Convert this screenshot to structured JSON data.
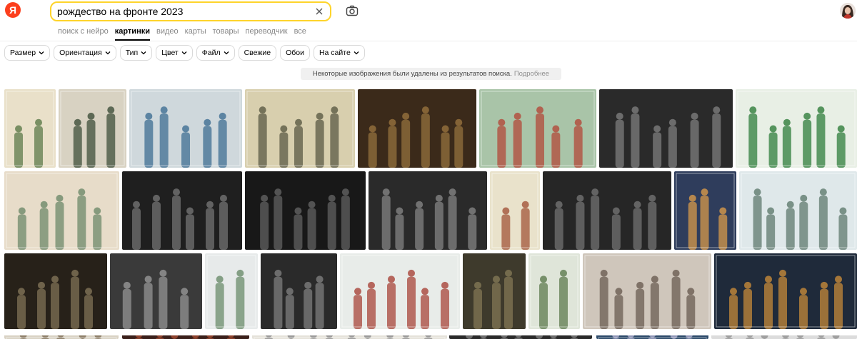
{
  "logo": {
    "letter": "Я"
  },
  "search": {
    "query": "рождество на фронте 2023"
  },
  "tabs": [
    {
      "label": "поиск с нейро",
      "active": false
    },
    {
      "label": "картинки",
      "active": true
    },
    {
      "label": "видео",
      "active": false
    },
    {
      "label": "карты",
      "active": false
    },
    {
      "label": "товары",
      "active": false
    },
    {
      "label": "переводчик",
      "active": false
    },
    {
      "label": "все",
      "active": false
    }
  ],
  "filters": [
    {
      "label": "Размер",
      "dropdown": true
    },
    {
      "label": "Ориентация",
      "dropdown": true
    },
    {
      "label": "Тип",
      "dropdown": true
    },
    {
      "label": "Цвет",
      "dropdown": true
    },
    {
      "label": "Файл",
      "dropdown": true
    },
    {
      "label": "Свежие",
      "dropdown": false
    },
    {
      "label": "Обои",
      "dropdown": false
    },
    {
      "label": "На сайте",
      "dropdown": true
    }
  ],
  "notice": {
    "text": "Некоторые изображения были удалены из результатов поиска.",
    "more": "Подробнее"
  },
  "colors": {
    "accent": "#fed42b",
    "logo": "#fc3f1d"
  }
}
